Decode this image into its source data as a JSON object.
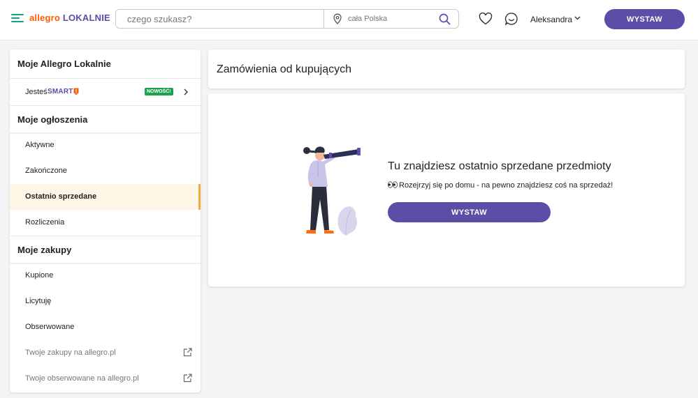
{
  "header": {
    "logo_part1": "allegro",
    "logo_part2": "LOKALNIE",
    "search_placeholder": "czego szukasz?",
    "location": "cała Polska",
    "user_name": "Aleksandra",
    "cta_label": "WYSTAW"
  },
  "sidebar": {
    "title": "Moje Allegro Lokalnie",
    "smart": {
      "prefix": "Jesteś",
      "brand": "SMART",
      "badge": "NOWOŚĆ!"
    },
    "sections": [
      {
        "title": "Moje ogłoszenia",
        "items": [
          {
            "label": "Aktywne"
          },
          {
            "label": "Zakończone"
          },
          {
            "label": "Ostatnio sprzedane"
          },
          {
            "label": "Rozliczenia"
          }
        ]
      },
      {
        "title": "Moje zakupy",
        "items": [
          {
            "label": "Kupione"
          },
          {
            "label": "Licytuję"
          },
          {
            "label": "Obserwowane"
          },
          {
            "label": "Twoje zakupy na allegro.pl"
          },
          {
            "label": "Twoje obserwowane na allegro.pl"
          }
        ]
      }
    ]
  },
  "main": {
    "page_title": "Zamówienia od kupujących",
    "empty_title": "Tu znajdziesz ostatnio sprzedane przedmioty",
    "empty_subtitle": "Rozejrzyj się po domu - na pewno znajdziesz coś na sprzedaż!",
    "cta_label": "WYSTAW"
  },
  "colors": {
    "brand_purple": "#5c4da6",
    "brand_orange": "#ff5a00",
    "teal": "#10a387",
    "active_bg": "#fdf5e6",
    "active_bar": "#f4ad3d",
    "badge_green": "#1aa34a"
  },
  "icons": [
    "menu-icon",
    "location-pin-icon",
    "search-icon",
    "heart-icon",
    "message-icon",
    "chevron-down-icon",
    "chevron-right-icon",
    "external-link-icon",
    "eyes-icon"
  ]
}
